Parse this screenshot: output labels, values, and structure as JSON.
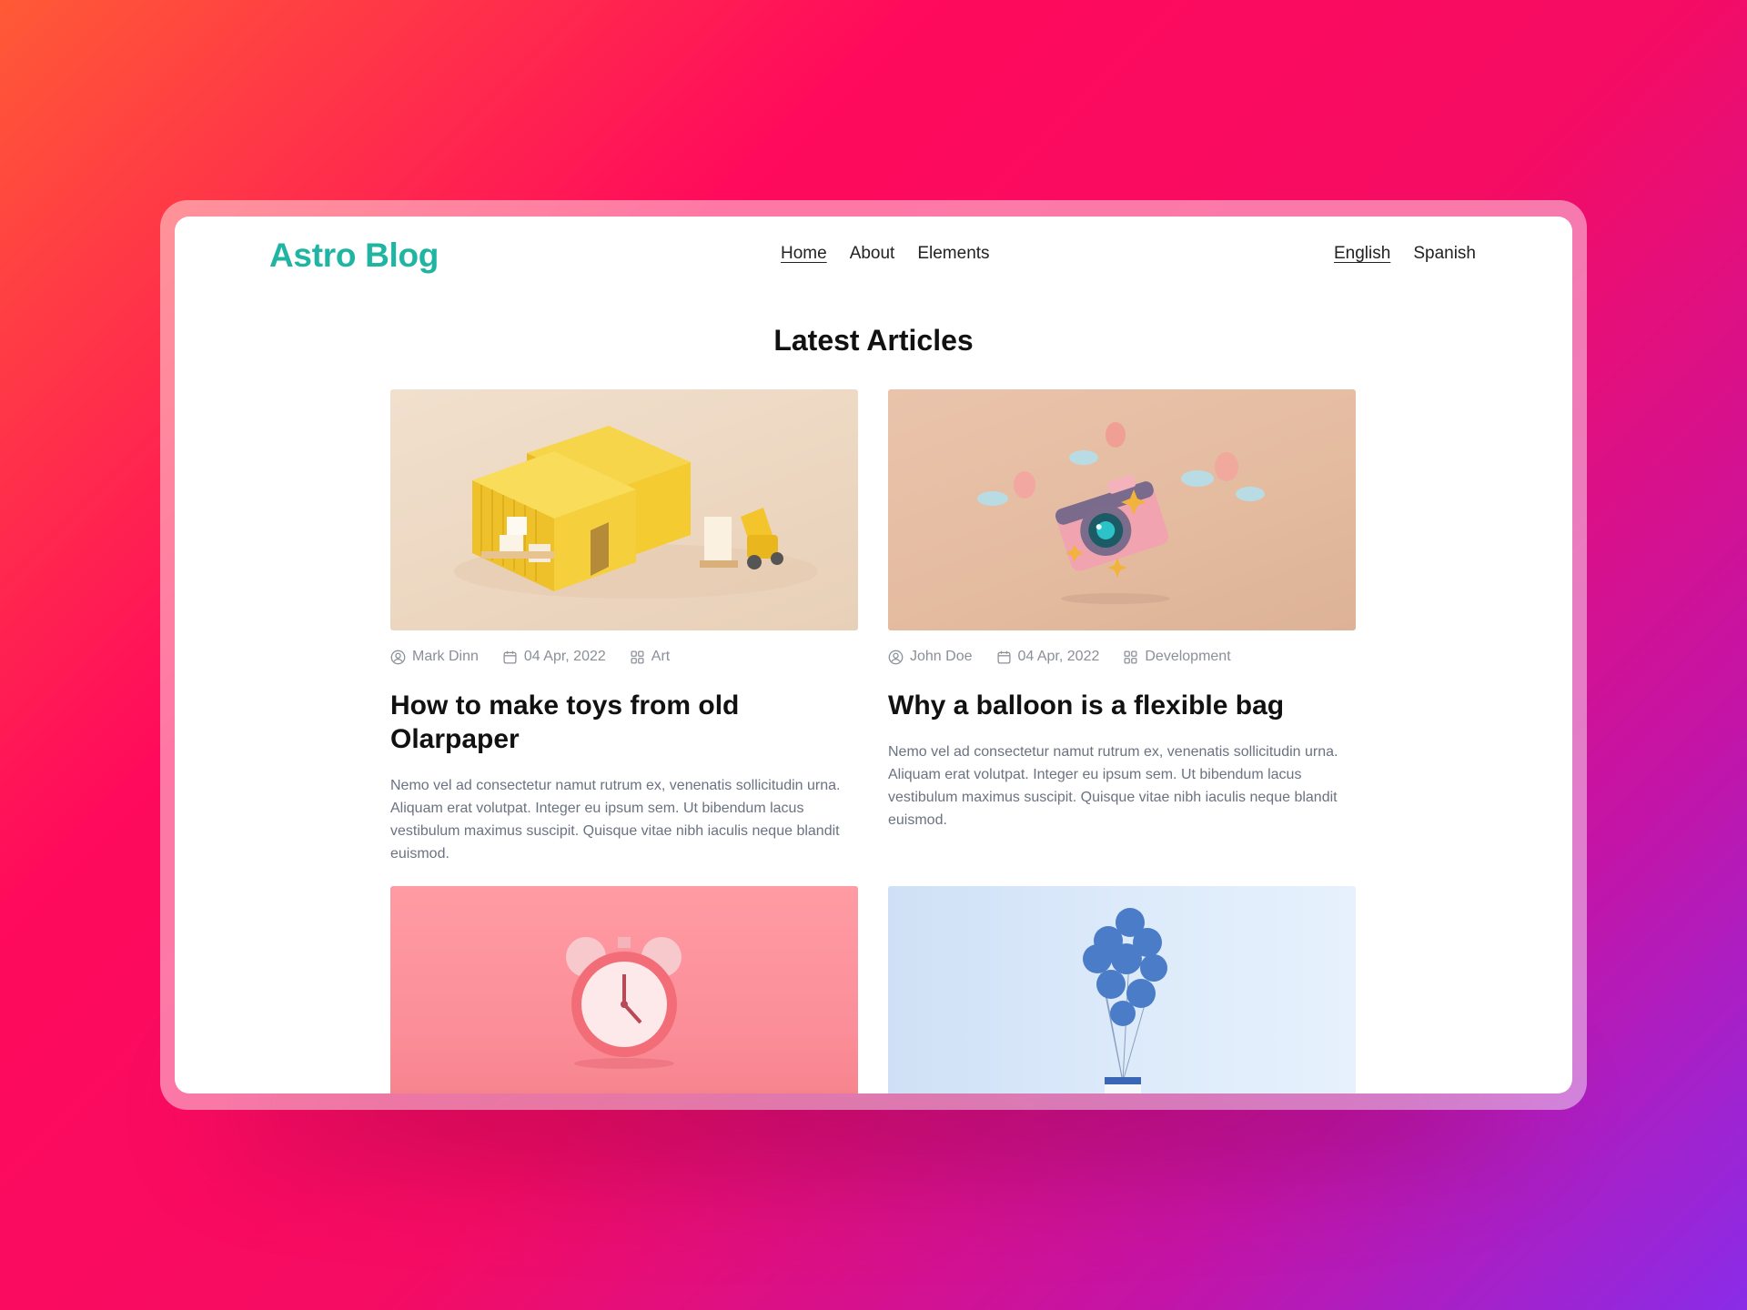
{
  "header": {
    "logo": "Astro Blog",
    "nav": [
      {
        "label": "Home",
        "active": true
      },
      {
        "label": "About",
        "active": false
      },
      {
        "label": "Elements",
        "active": false
      }
    ],
    "languages": [
      {
        "label": "English",
        "active": true
      },
      {
        "label": "Spanish",
        "active": false
      }
    ]
  },
  "main": {
    "title": "Latest Articles",
    "articles": [
      {
        "author": "Mark Dinn",
        "date": "04 Apr, 2022",
        "category": "Art",
        "title": "How to make toys from old Olarpaper",
        "excerpt": "Nemo vel ad consectetur namut rutrum ex, venenatis sollicitudin urna. Aliquam erat volutpat. Integer eu ipsum sem. Ut bibendum lacus vestibulum maximus suscipit. Quisque vitae nibh iaculis neque blandit euismod.",
        "image": "yellow-shipping-containers-forklift"
      },
      {
        "author": "John Doe",
        "date": "04 Apr, 2022",
        "category": "Development",
        "title": "Why a balloon is a flexible bag",
        "excerpt": "Nemo vel ad consectetur namut rutrum ex, venenatis sollicitudin urna. Aliquam erat volutpat. Integer eu ipsum sem. Ut bibendum lacus vestibulum maximus suscipit. Quisque vitae nibh iaculis neque blandit euismod.",
        "image": "pink-camera-balloons-clouds"
      },
      {
        "image": "pink-alarm-clock"
      },
      {
        "image": "blue-balloons-gift"
      }
    ]
  },
  "icons": {
    "author": "user-circle-icon",
    "date": "calendar-icon",
    "category": "grid-icon"
  },
  "colors": {
    "brand": "#1fb5a2",
    "text": "#111111",
    "muted": "#8a8f98"
  }
}
